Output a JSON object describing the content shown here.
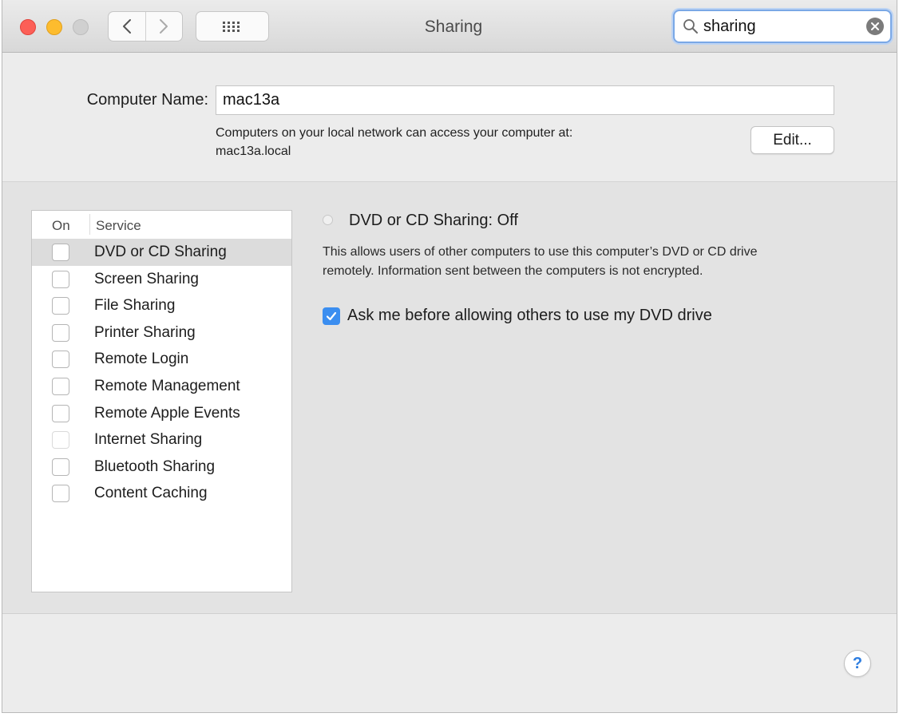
{
  "window": {
    "title": "Sharing"
  },
  "search": {
    "value": "sharing",
    "icon": "magnifier-icon"
  },
  "computer_name": {
    "label": "Computer Name:",
    "value": "mac13a",
    "access_line1": "Computers on your local network can access your computer at:",
    "access_line2": "mac13a.local",
    "edit_label": "Edit..."
  },
  "services": {
    "header_on": "On",
    "header_service": "Service",
    "items": [
      {
        "label": "DVD or CD Sharing",
        "checked": false,
        "selected": true
      },
      {
        "label": "Screen Sharing",
        "checked": false
      },
      {
        "label": "File Sharing",
        "checked": false
      },
      {
        "label": "Printer Sharing",
        "checked": false
      },
      {
        "label": "Remote Login",
        "checked": false
      },
      {
        "label": "Remote Management",
        "checked": false
      },
      {
        "label": "Remote Apple Events",
        "checked": false
      },
      {
        "label": "Internet Sharing",
        "checked": false,
        "disabled": true
      },
      {
        "label": "Bluetooth Sharing",
        "checked": false
      },
      {
        "label": "Content Caching",
        "checked": false
      }
    ]
  },
  "detail": {
    "status": "DVD or CD Sharing: Off",
    "description_line1": "This allows users of other computers to use this computer’s DVD or CD drive",
    "description_line2": "remotely. Information sent between the computers is not encrypted.",
    "ask_label": "Ask me before allowing others to use my DVD drive",
    "ask_checked": true
  },
  "help": {
    "label": "?"
  },
  "colors": {
    "accent": "#3b8ef0",
    "close": "#fc5f57",
    "minimize": "#fdbc2e"
  }
}
